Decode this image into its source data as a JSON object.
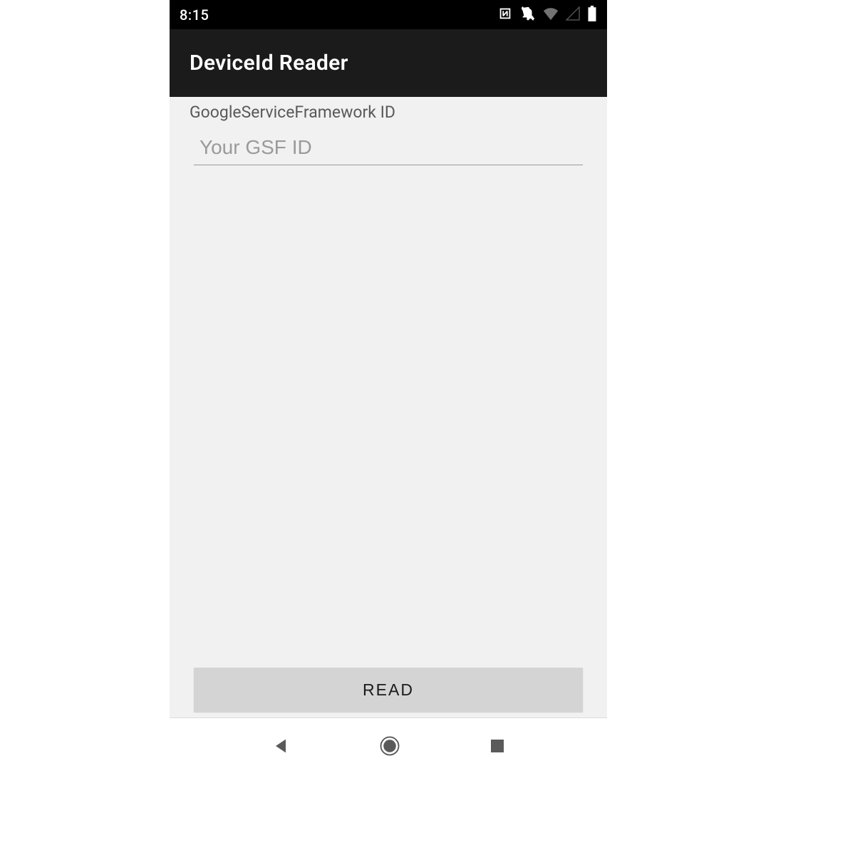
{
  "status_bar": {
    "time": "8:15"
  },
  "app_bar": {
    "title": "DeviceId Reader"
  },
  "main": {
    "field_label": "GoogleServiceFramework ID",
    "gsf_input_value": "",
    "gsf_input_placeholder": "Your GSF ID",
    "read_button_label": "READ"
  }
}
